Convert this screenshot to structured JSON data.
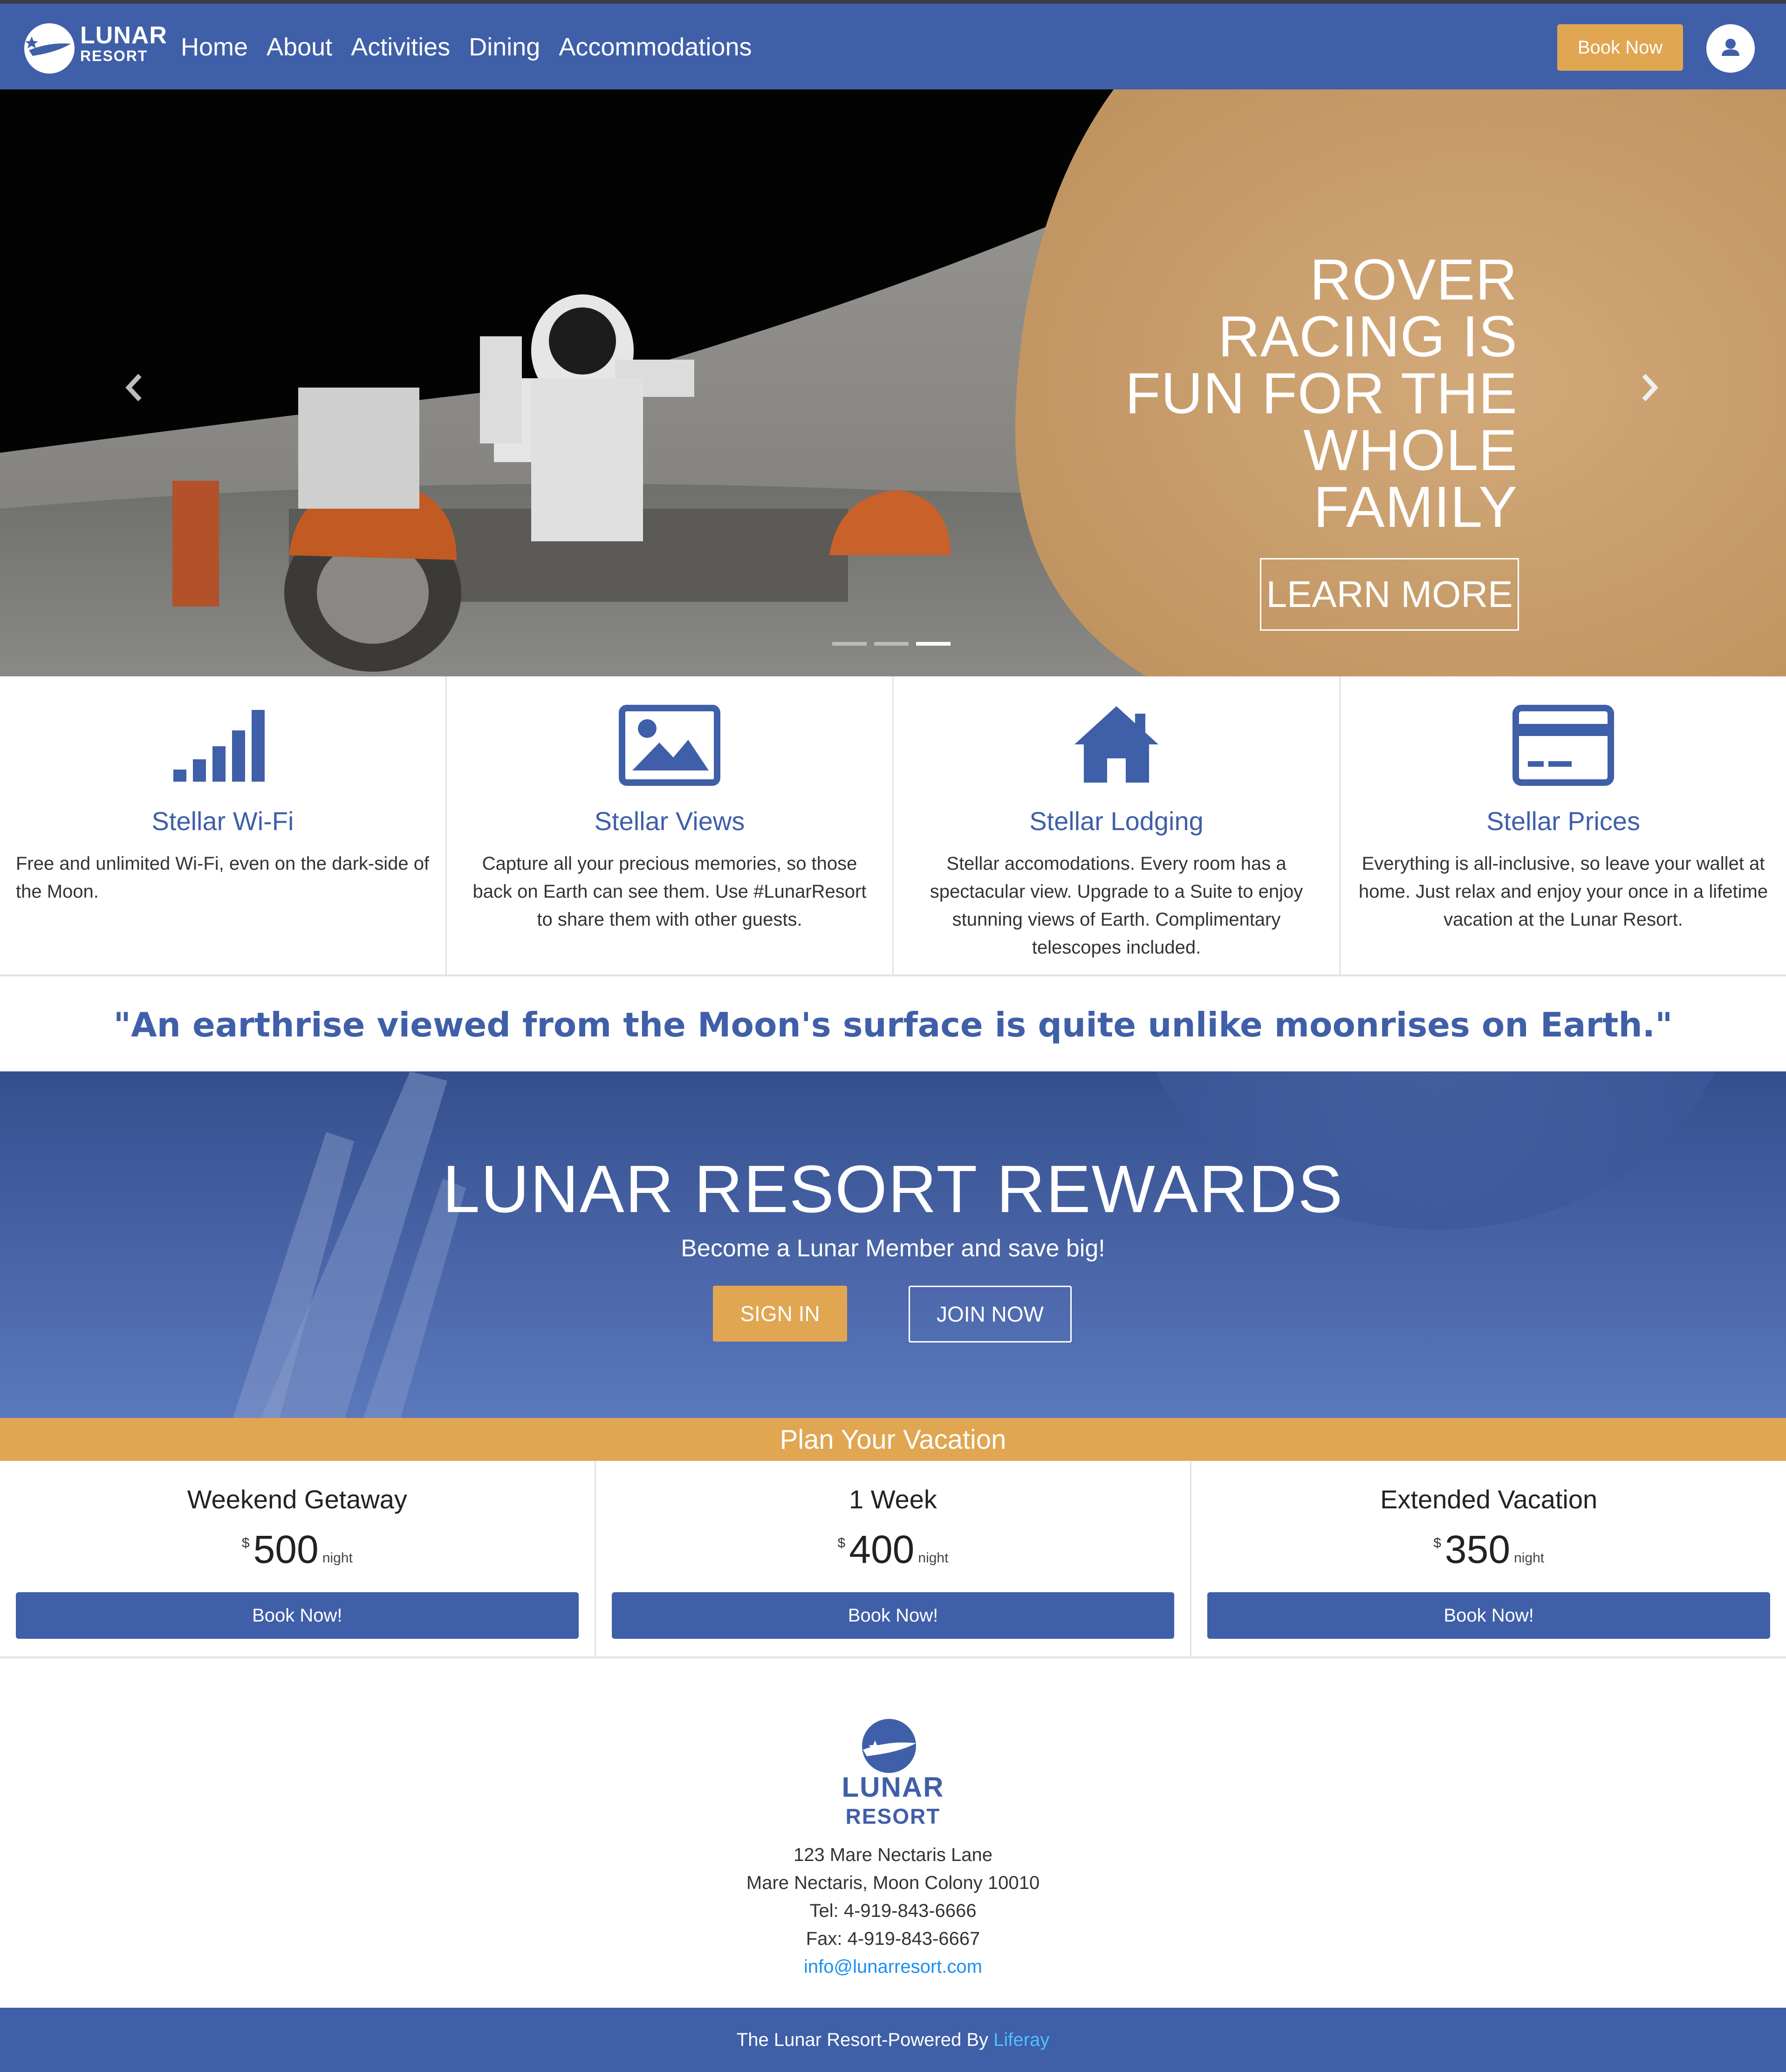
{
  "brand": {
    "line1": "LUNAR",
    "line2": "RESORT"
  },
  "nav": {
    "items": [
      "Home",
      "About",
      "Activities",
      "Dining",
      "Accommodations"
    ],
    "book_now": "Book Now"
  },
  "hero": {
    "title": "ROVER RACING IS FUN FOR THE WHOLE FAMILY",
    "cta": "LEARN MORE",
    "slide_count": 3,
    "active_slide": 3
  },
  "features": [
    {
      "icon": "signal-bars-icon",
      "title": "Stellar Wi-Fi",
      "desc": "Free and unlimited Wi-Fi, even on the dark-side of the Moon."
    },
    {
      "icon": "image-icon",
      "title": "Stellar Views",
      "desc": "Capture all your precious memories, so those back on Earth can see them. Use #LunarResort to share them with other guests."
    },
    {
      "icon": "home-icon",
      "title": "Stellar Lodging",
      "desc": "Stellar accomodations. Every room has a spectacular view. Upgrade to a Suite to enjoy stunning views of Earth. Complimentary telescopes included."
    },
    {
      "icon": "credit-card-icon",
      "title": "Stellar Prices",
      "desc": "Everything is all-inclusive, so leave your wallet at home. Just relax and enjoy your once in a lifetime vacation at the Lunar Resort."
    }
  ],
  "quote": "\"An earthrise viewed from the Moon's surface is quite unlike moonrises on Earth.\"",
  "rewards": {
    "title": "LUNAR RESORT REWARDS",
    "subtitle": "Become a Lunar Member and save big!",
    "sign_in": "SIGN IN",
    "join_now": "JOIN NOW"
  },
  "plan": {
    "title": "Plan Your Vacation",
    "packages": [
      {
        "name": "Weekend Getaway",
        "currency": "$",
        "price": "500",
        "unit": "night",
        "cta": "Book Now!"
      },
      {
        "name": "1 Week",
        "currency": "$",
        "price": "400",
        "unit": "night",
        "cta": "Book Now!"
      },
      {
        "name": "Extended Vacation",
        "currency": "$",
        "price": "350",
        "unit": "night",
        "cta": "Book Now!"
      }
    ]
  },
  "footer": {
    "logo_line1": "LUNAR",
    "logo_line2": "RESORT",
    "address1": "123 Mare Nectaris Lane",
    "address2": "Mare Nectaris, Moon Colony 10010",
    "tel": "Tel: 4-919-843-6666",
    "fax": "Fax: 4-919-843-6667",
    "email": "info@lunarresort.com",
    "powered_prefix": "The Lunar Resort-Powered By ",
    "powered_link": "Liferay"
  },
  "colors": {
    "primary": "#3f5fa8",
    "accent": "#e0a652",
    "link": "#1b8ef2"
  }
}
